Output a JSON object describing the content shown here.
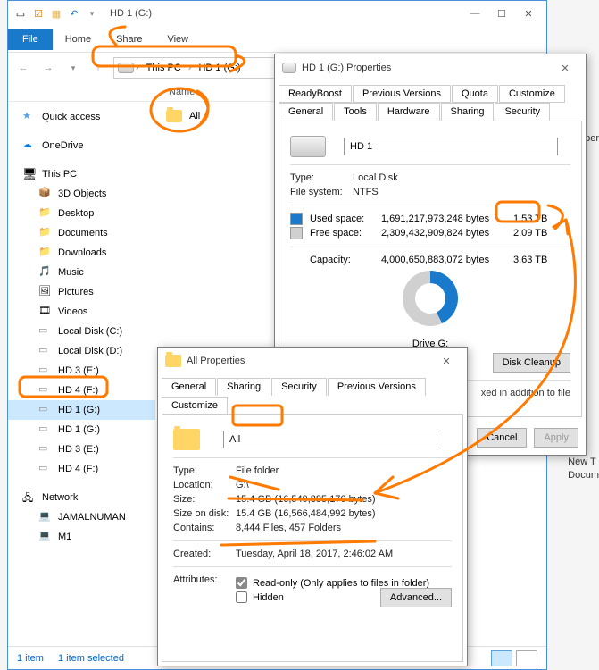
{
  "explorer": {
    "title": "HD 1 (G:)",
    "qat": [
      "▭",
      "☑",
      "▦",
      "↶",
      "▾"
    ],
    "win_ctrls": [
      "—",
      "☐",
      "✕"
    ],
    "menu": {
      "file": "File",
      "home": "Home",
      "share": "Share",
      "view": "View"
    },
    "nav": {
      "back": "←",
      "fwd": "→",
      "down": "▾",
      "up": "↑"
    },
    "breadcrumb": [
      "This PC",
      "HD 1 (G:)"
    ],
    "columns": {
      "name": "Name"
    },
    "sidebar": [
      {
        "icon": "i-star",
        "label": "Quick access",
        "indent": false
      },
      {
        "sep": true
      },
      {
        "icon": "i-cloud",
        "label": "OneDrive",
        "indent": false
      },
      {
        "sep": true
      },
      {
        "icon": "i-pc",
        "label": "This PC",
        "indent": false
      },
      {
        "icon": "i-folder-3d",
        "label": "3D Objects",
        "indent": true
      },
      {
        "icon": "i-folder",
        "label": "Desktop",
        "indent": true
      },
      {
        "icon": "i-folder",
        "label": "Documents",
        "indent": true
      },
      {
        "icon": "i-folder",
        "label": "Downloads",
        "indent": true
      },
      {
        "icon": "i-music",
        "label": "Music",
        "indent": true
      },
      {
        "icon": "i-pic",
        "label": "Pictures",
        "indent": true
      },
      {
        "icon": "i-vid",
        "label": "Videos",
        "indent": true
      },
      {
        "icon": "i-drive",
        "label": "Local Disk (C:)",
        "indent": true
      },
      {
        "icon": "i-drive",
        "label": "Local Disk (D:)",
        "indent": true
      },
      {
        "icon": "i-drive",
        "label": "HD 3 (E:)",
        "indent": true
      },
      {
        "icon": "i-drive",
        "label": "HD 4 (F:)",
        "indent": true
      },
      {
        "icon": "i-drive",
        "label": "HD 1 (G:)",
        "indent": true,
        "selected": true
      },
      {
        "icon": "i-drive",
        "label": "HD 1 (G:)",
        "indent": true
      },
      {
        "icon": "i-drive",
        "label": "HD 3 (E:)",
        "indent": true
      },
      {
        "icon": "i-drive",
        "label": "HD 4 (F:)",
        "indent": true
      },
      {
        "sep": true
      },
      {
        "icon": "i-net",
        "label": "Network",
        "indent": false
      },
      {
        "icon": "i-comp",
        "label": "JAMALNUMAN",
        "indent": true
      },
      {
        "icon": "i-comp",
        "label": "M1",
        "indent": true
      }
    ],
    "files": [
      {
        "name": "All"
      }
    ],
    "status": {
      "count": "1 item",
      "sel": "1 item selected"
    }
  },
  "drive_props": {
    "title": "HD 1 (G:) Properties",
    "tabs_row2": [
      "ReadyBoost",
      "Previous Versions",
      "Quota",
      "Customize"
    ],
    "tabs_row1": [
      "General",
      "Tools",
      "Hardware",
      "Sharing",
      "Security"
    ],
    "active_tab": "General",
    "name_value": "HD 1",
    "rows": {
      "type_l": "Type:",
      "type_v": "Local Disk",
      "fs_l": "File system:",
      "fs_v": "NTFS",
      "used_l": "Used space:",
      "used_b": "1,691,217,973,248 bytes",
      "used_hr": "1.53 TB",
      "free_l": "Free space:",
      "free_b": "2,309,432,909,824 bytes",
      "free_hr": "2.09 TB",
      "cap_l": "Capacity:",
      "cap_b": "4,000,650,883,072 bytes",
      "cap_hr": "3.63 TB"
    },
    "drive_label": "Drive G:",
    "disk_cleanup": "Disk Cleanup",
    "note_frag": "xed in addition to file",
    "btns": {
      "cancel": "Cancel",
      "apply": "Apply"
    }
  },
  "folder_props": {
    "title": "All Properties",
    "tabs": [
      "General",
      "Sharing",
      "Security",
      "Previous Versions",
      "Customize"
    ],
    "active_tab": "General",
    "name_value": "All",
    "rows": {
      "type_l": "Type:",
      "type_v": "File folder",
      "loc_l": "Location:",
      "loc_v": "G:\\",
      "size_l": "Size:",
      "size_v": "15.4 GB (16,549,885,176 bytes)",
      "sod_l": "Size on disk:",
      "sod_v": "15.4 GB (16,566,484,992 bytes)",
      "con_l": "Contains:",
      "con_v": "8,444 Files, 457 Folders",
      "created_l": "Created:",
      "created_v": "Tuesday, April 18, 2017, 2:46:02 AM",
      "attr_l": "Attributes:",
      "ro": "Read-only (Only applies to files in folder)",
      "hidden": "Hidden",
      "adv": "Advanced..."
    }
  },
  "side_text": {
    "per": "per",
    "news": "New T",
    "docu": "Docum"
  }
}
